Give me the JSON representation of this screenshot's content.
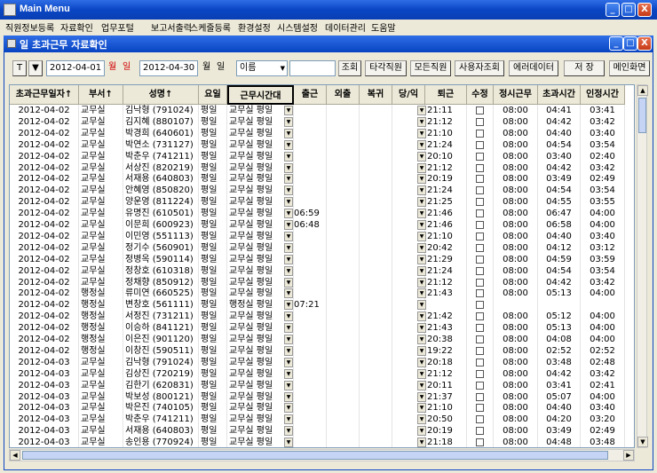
{
  "window": {
    "title": "Main Menu",
    "min": "_",
    "max": "□",
    "close": "X"
  },
  "menu": [
    "직원정보등록",
    "자료확인",
    "업무포털",
    "보고서출력",
    "스케줄등록",
    "환경설정",
    "시스템설정",
    "데이터관리",
    "도움말"
  ],
  "child": {
    "title": "일 초과근무 자료확인"
  },
  "toolbar": {
    "t_label": "T",
    "date_from": "2012-04-01",
    "month_label": "월",
    "day_label": "일",
    "date_to": "2012-04-30",
    "month_label2": "월",
    "search_type": "이름",
    "search_value": "",
    "search_btn": "조회",
    "btn_other": "타각직원",
    "btn_all": "모든직원",
    "btn_user_search": "사용자조회",
    "btn_error": "에러데이터",
    "btn_save": "저 장",
    "btn_main": "메인화면"
  },
  "columns": [
    "초과근무일자↑",
    "부서↑",
    "성명↑",
    "요일",
    "근무시간대",
    "출근",
    "외출",
    "복귀",
    "당/익",
    "퇴근",
    "수정",
    "정시근무",
    "초과시간",
    "인정시간"
  ],
  "rows": [
    [
      "2012-04-02",
      "교무실",
      "김낙형 (791024)",
      "평일",
      "교무실 평일",
      "",
      "",
      "",
      "",
      "21:11",
      "",
      "08:00",
      "04:41",
      "03:41"
    ],
    [
      "2012-04-02",
      "교무실",
      "김지혜 (880107)",
      "평일",
      "교무실 평일",
      "",
      "",
      "",
      "",
      "21:12",
      "",
      "08:00",
      "04:42",
      "03:42"
    ],
    [
      "2012-04-02",
      "교무실",
      "박경희 (640601)",
      "평일",
      "교무실 평일",
      "",
      "",
      "",
      "",
      "21:10",
      "",
      "08:00",
      "04:40",
      "03:40"
    ],
    [
      "2012-04-02",
      "교무실",
      "박연소 (731127)",
      "평일",
      "교무실 평일",
      "",
      "",
      "",
      "",
      "21:24",
      "",
      "08:00",
      "04:54",
      "03:54"
    ],
    [
      "2012-04-02",
      "교무실",
      "박춘우 (741211)",
      "평일",
      "교무실 평일",
      "",
      "",
      "",
      "",
      "20:10",
      "",
      "08:00",
      "03:40",
      "02:40"
    ],
    [
      "2012-04-02",
      "교무실",
      "서상진 (820219)",
      "평일",
      "교무실 평일",
      "",
      "",
      "",
      "",
      "21:12",
      "",
      "08:00",
      "04:42",
      "03:42"
    ],
    [
      "2012-04-02",
      "교무실",
      "서재용 (640803)",
      "평일",
      "교무실 평일",
      "",
      "",
      "",
      "",
      "20:19",
      "",
      "08:00",
      "03:49",
      "02:49"
    ],
    [
      "2012-04-02",
      "교무실",
      "안혜영 (850820)",
      "평일",
      "교무실 평일",
      "",
      "",
      "",
      "",
      "21:24",
      "",
      "08:00",
      "04:54",
      "03:54"
    ],
    [
      "2012-04-02",
      "교무실",
      "양운영 (811224)",
      "평일",
      "교무실 평일",
      "",
      "",
      "",
      "",
      "21:25",
      "",
      "08:00",
      "04:55",
      "03:55"
    ],
    [
      "2012-04-02",
      "교무실",
      "유명진 (610501)",
      "평일",
      "교무실 평일",
      "06:59",
      "",
      "",
      "",
      "21:46",
      "",
      "08:00",
      "06:47",
      "04:00"
    ],
    [
      "2012-04-02",
      "교무실",
      "이문희 (600923)",
      "평일",
      "교무실 평일",
      "06:48",
      "",
      "",
      "",
      "21:46",
      "",
      "08:00",
      "06:58",
      "04:00"
    ],
    [
      "2012-04-02",
      "교무실",
      "이민영 (551113)",
      "평일",
      "교무실 평일",
      "",
      "",
      "",
      "",
      "21:10",
      "",
      "08:00",
      "04:40",
      "03:40"
    ],
    [
      "2012-04-02",
      "교무실",
      "정기수 (560901)",
      "평일",
      "교무실 평일",
      "",
      "",
      "",
      "",
      "20:42",
      "",
      "08:00",
      "04:12",
      "03:12"
    ],
    [
      "2012-04-02",
      "교무실",
      "정병옥 (590114)",
      "평일",
      "교무실 평일",
      "",
      "",
      "",
      "",
      "21:29",
      "",
      "08:00",
      "04:59",
      "03:59"
    ],
    [
      "2012-04-02",
      "교무실",
      "정창호 (610318)",
      "평일",
      "교무실 평일",
      "",
      "",
      "",
      "",
      "21:24",
      "",
      "08:00",
      "04:54",
      "03:54"
    ],
    [
      "2012-04-02",
      "교무실",
      "정채향 (850912)",
      "평일",
      "교무실 평일",
      "",
      "",
      "",
      "",
      "21:12",
      "",
      "08:00",
      "04:42",
      "03:42"
    ],
    [
      "2012-04-02",
      "행정실",
      "류미연 (660525)",
      "평일",
      "교무실 평일",
      "",
      "",
      "",
      "",
      "21:43",
      "",
      "08:00",
      "05:13",
      "04:00"
    ],
    [
      "2012-04-02",
      "행정실",
      "변창호 (561111)",
      "평일",
      "행정실 평일",
      "07:21",
      "",
      "",
      "",
      "",
      "",
      "",
      "",
      ""
    ],
    [
      "2012-04-02",
      "행정실",
      "서정진 (731211)",
      "평일",
      "교무실 평일",
      "",
      "",
      "",
      "",
      "21:42",
      "",
      "08:00",
      "05:12",
      "04:00"
    ],
    [
      "2012-04-02",
      "행정실",
      "이승하 (841121)",
      "평일",
      "교무실 평일",
      "",
      "",
      "",
      "",
      "21:43",
      "",
      "08:00",
      "05:13",
      "04:00"
    ],
    [
      "2012-04-02",
      "행정실",
      "이은진 (901120)",
      "평일",
      "교무실 평일",
      "",
      "",
      "",
      "",
      "20:38",
      "",
      "08:00",
      "04:08",
      "04:00"
    ],
    [
      "2012-04-02",
      "행정실",
      "이창진 (590511)",
      "평일",
      "교무실 평일",
      "",
      "",
      "",
      "",
      "19:22",
      "",
      "08:00",
      "02:52",
      "02:52"
    ],
    [
      "2012-04-03",
      "교무실",
      "김낙형 (791024)",
      "평일",
      "교무실 평일",
      "",
      "",
      "",
      "",
      "20:18",
      "",
      "08:00",
      "03:48",
      "02:48"
    ],
    [
      "2012-04-03",
      "교무실",
      "김상진 (720219)",
      "평일",
      "교무실 평일",
      "",
      "",
      "",
      "",
      "21:12",
      "",
      "08:00",
      "04:42",
      "03:42"
    ],
    [
      "2012-04-03",
      "교무실",
      "김한기 (620831)",
      "평일",
      "교무실 평일",
      "",
      "",
      "",
      "",
      "20:11",
      "",
      "08:00",
      "03:41",
      "02:41"
    ],
    [
      "2012-04-03",
      "교무실",
      "박보성 (800121)",
      "평일",
      "교무실 평일",
      "",
      "",
      "",
      "",
      "21:37",
      "",
      "08:00",
      "05:07",
      "04:00"
    ],
    [
      "2012-04-03",
      "교무실",
      "박은진 (740105)",
      "평일",
      "교무실 평일",
      "",
      "",
      "",
      "",
      "21:10",
      "",
      "08:00",
      "04:40",
      "03:40"
    ],
    [
      "2012-04-03",
      "교무실",
      "박춘우 (741211)",
      "평일",
      "교무실 평일",
      "",
      "",
      "",
      "",
      "20:50",
      "",
      "08:00",
      "04:20",
      "03:20"
    ],
    [
      "2012-04-03",
      "교무실",
      "서재용 (640803)",
      "평일",
      "교무실 평일",
      "",
      "",
      "",
      "",
      "20:19",
      "",
      "08:00",
      "03:49",
      "02:49"
    ],
    [
      "2012-04-03",
      "교무실",
      "송인용 (770924)",
      "평일",
      "교무실 평일",
      "",
      "",
      "",
      "",
      "21:18",
      "",
      "08:00",
      "04:48",
      "03:48"
    ]
  ]
}
